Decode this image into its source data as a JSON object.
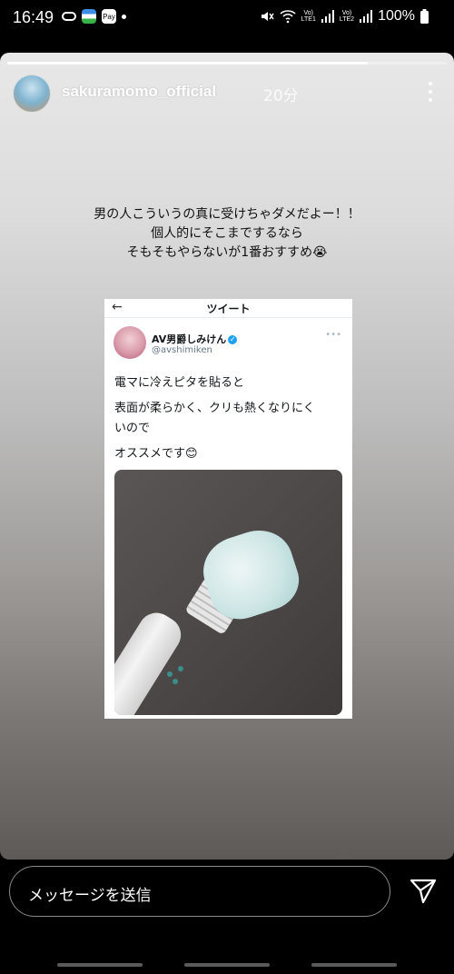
{
  "status_bar": {
    "time": "16:49",
    "pay_label": "Pay",
    "lte1_line1": "Vo)",
    "lte1_line2": "LTE1",
    "lte2_line1": "Vo)",
    "lte2_line2": "LTE2",
    "battery": "100%"
  },
  "story": {
    "progress": 0.82,
    "username": "sakuramomo_official",
    "time_ago": "20分",
    "caption": [
      "男の人こういうの真に受けちゃダメだよー！！",
      "個人的にそこまでするなら",
      "そもそもやらないが1番おすすめ😭"
    ]
  },
  "tweet": {
    "header_title": "ツイート",
    "name": "AV男爵しみけん",
    "handle": "@avshimiken",
    "text_lines": [
      "電マに冷えピタを貼ると",
      "表面が柔らかく、クリも熱くなりにく",
      "いので",
      "オススメです😊"
    ]
  },
  "message_bar": {
    "placeholder": "メッセージを送信"
  },
  "icons": {
    "more": "more-vertical-icon",
    "send": "send-icon",
    "back": "back-arrow-icon",
    "verified": "verified-badge-icon"
  },
  "colors": {
    "twitter_blue": "#1da1f2",
    "background": "#000000"
  }
}
